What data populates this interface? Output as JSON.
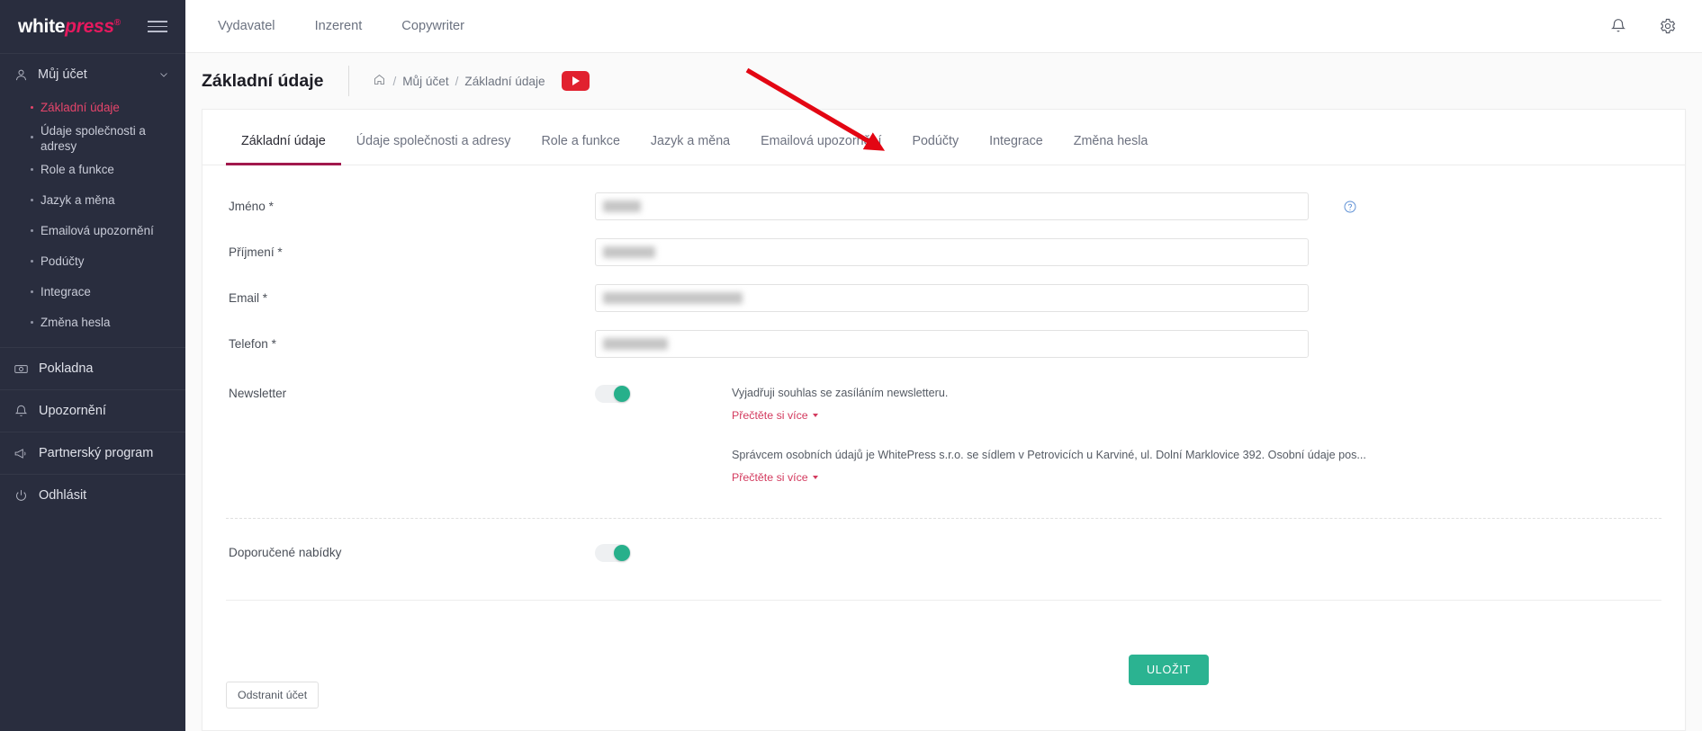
{
  "brand": {
    "logo_white": "white",
    "logo_press": "press",
    "logo_reg": "®",
    "accent_pink": "#e5195e",
    "accent_green": "#2bb391",
    "accent_tab": "#a1184c"
  },
  "sidebar": {
    "account": {
      "label": "Můj účet",
      "icon": "user-icon",
      "expanded": true,
      "items": [
        {
          "label": "Základní údaje",
          "active": true
        },
        {
          "label": "Údaje společnosti a adresy",
          "active": false
        },
        {
          "label": "Role a funkce",
          "active": false
        },
        {
          "label": "Jazyk a měna",
          "active": false
        },
        {
          "label": "Emailová upozornění",
          "active": false
        },
        {
          "label": "Podúčty",
          "active": false
        },
        {
          "label": "Integrace",
          "active": false
        },
        {
          "label": "Změna hesla",
          "active": false
        }
      ]
    },
    "links": [
      {
        "label": "Pokladna",
        "icon": "cash-icon"
      },
      {
        "label": "Upozornění",
        "icon": "bell-icon"
      },
      {
        "label": "Partnerský program",
        "icon": "megaphone-icon"
      },
      {
        "label": "Odhlásit",
        "icon": "power-icon"
      }
    ]
  },
  "topbar": {
    "nav": [
      {
        "label": "Vydavatel"
      },
      {
        "label": "Inzerent"
      },
      {
        "label": "Copywriter"
      }
    ],
    "icons": [
      {
        "name": "bell-icon"
      },
      {
        "name": "gear-icon"
      }
    ]
  },
  "pagehead": {
    "title": "Základní údaje",
    "breadcrumb": {
      "home_icon": "home-icon",
      "sep": "/",
      "items": [
        {
          "label": "Můj účet"
        },
        {
          "label": "Základní údaje"
        }
      ]
    },
    "video_button": "youtube-play-icon"
  },
  "tabs": [
    {
      "label": "Základní údaje",
      "active": true
    },
    {
      "label": "Údaje společnosti a adresy",
      "active": false
    },
    {
      "label": "Role a funkce",
      "active": false
    },
    {
      "label": "Jazyk a měna",
      "active": false
    },
    {
      "label": "Emailová upozornění",
      "active": false
    },
    {
      "label": "Podúčty",
      "active": false
    },
    {
      "label": "Integrace",
      "active": false
    },
    {
      "label": "Změna hesla",
      "active": false
    }
  ],
  "form": {
    "fields": [
      {
        "label": "Jméno *",
        "value": "",
        "redacted_width": 42
      },
      {
        "label": "Příjmení *",
        "value": "",
        "redacted_width": 58
      },
      {
        "label": "Email *",
        "value": "",
        "redacted_width": 155
      },
      {
        "label": "Telefon *",
        "value": "",
        "redacted_width": 72
      }
    ],
    "help_icon": "help-circle-icon",
    "newsletter": {
      "label": "Newsletter",
      "toggle_on": true,
      "consent_text": "Vyjadřuji souhlas se zasíláním newsletteru.",
      "read_more": "Přečtěte si více",
      "privacy_text": "Správcem osobních údajů je WhitePress s.r.o. se sídlem v Petrovicích u Karviné, ul. Dolní Marklovice 392. Osobní údaje pos...",
      "privacy_read_more": "Přečtěte si více"
    },
    "recommended": {
      "label": "Doporučené nabídky",
      "toggle_on": true
    }
  },
  "actions": {
    "save": "ULOŽIT",
    "delete_account": "Odstranit účet"
  },
  "annotation": {
    "type": "red-arrow",
    "points_to": "Podúčty",
    "color": "#e30613"
  }
}
